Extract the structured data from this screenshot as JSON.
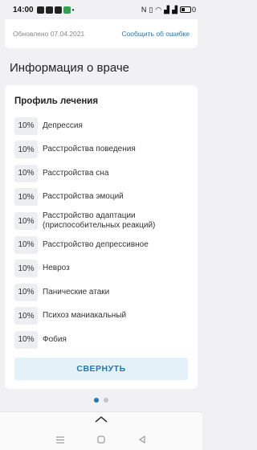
{
  "status_bar": {
    "time": "14:00",
    "indicators": "N",
    "battery": "0"
  },
  "top_card": {
    "updated": "Обновлено 07.04.2021",
    "report_link": "Сообщить об ошибке"
  },
  "section": {
    "title": "Информация о враче"
  },
  "profile": {
    "title": "Профиль лечения",
    "items": [
      {
        "percent": "10%",
        "label": "Депрессия"
      },
      {
        "percent": "10%",
        "label": "Расстройства поведения"
      },
      {
        "percent": "10%",
        "label": "Расстройства сна"
      },
      {
        "percent": "10%",
        "label": "Расстройства эмоций"
      },
      {
        "percent": "10%",
        "label": "Расстройство адаптации (приспособительных реакций)"
      },
      {
        "percent": "10%",
        "label": "Расстройство депрессивное"
      },
      {
        "percent": "10%",
        "label": "Невроз"
      },
      {
        "percent": "10%",
        "label": "Панические атаки"
      },
      {
        "percent": "10%",
        "label": "Психоз маниакальный"
      },
      {
        "percent": "10%",
        "label": "Фобия"
      }
    ],
    "collapse_label": "СВЕРНУТЬ"
  },
  "colors": {
    "accent": "#1f78b4",
    "badge_bg": "#eceef2",
    "button_bg": "#e3f1f9"
  }
}
